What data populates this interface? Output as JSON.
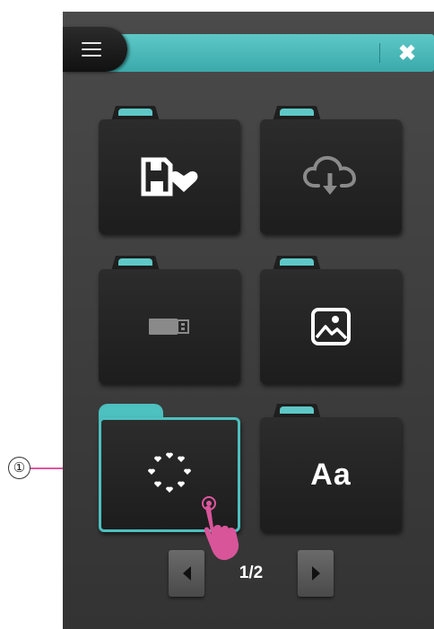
{
  "header": {
    "menu_icon": "hamburger-menu-icon",
    "close_icon": "close-x-icon",
    "close_glyph": "✖",
    "accent_color": "#4dc0c0"
  },
  "folders": [
    {
      "icon": "favorites-save-heart-icon"
    },
    {
      "icon": "cloud-download-icon"
    },
    {
      "icon": "usb-drive-icon"
    },
    {
      "icon": "picture-image-icon"
    },
    {
      "icon": "heart-circle-pattern-icon",
      "selected": true,
      "check_glyph": "✔"
    },
    {
      "icon": "text-font-icon",
      "label": "Aa"
    }
  ],
  "pager": {
    "page_label": "1/2",
    "prev_icon": "left-arrow-icon",
    "next_icon": "right-arrow-icon"
  },
  "callout": {
    "marker": "①",
    "color": "#e0569f"
  }
}
